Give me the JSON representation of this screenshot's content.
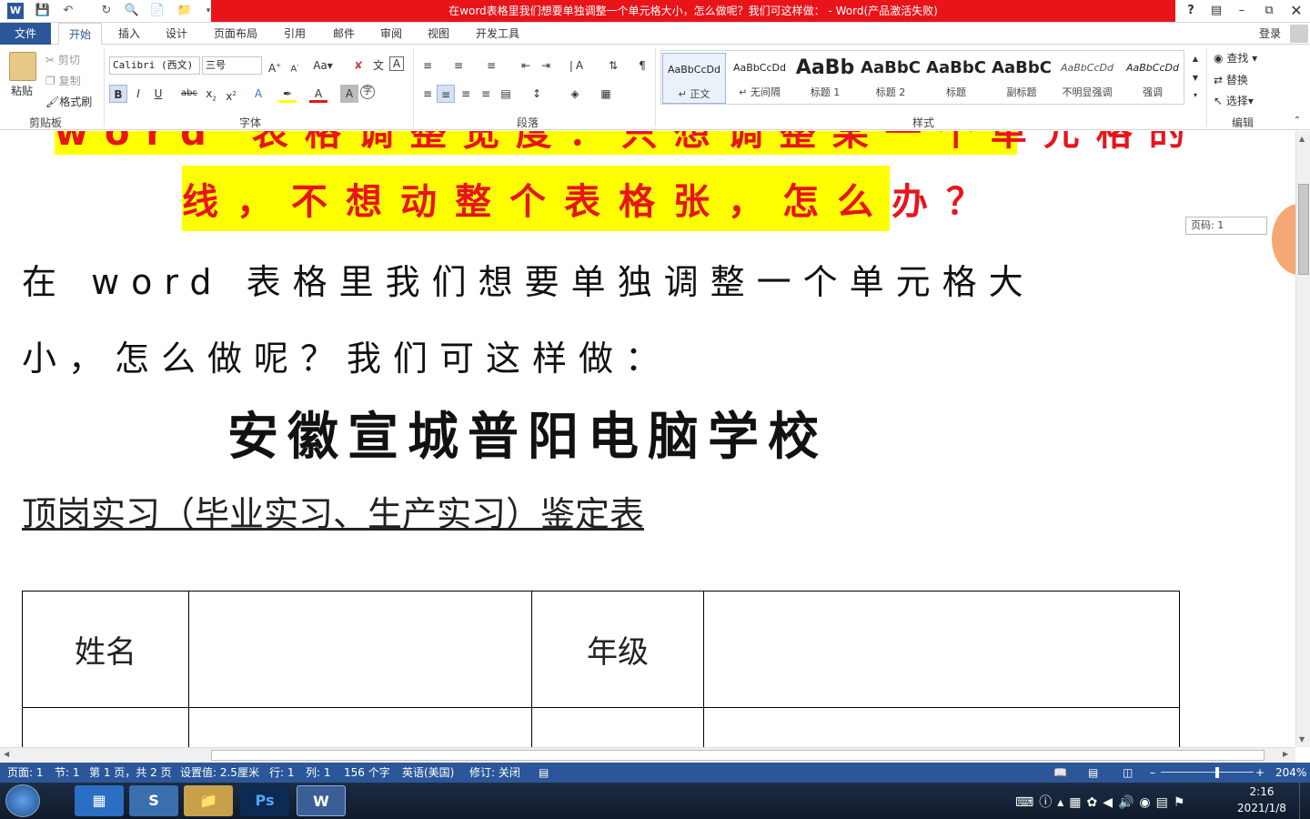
{
  "window": {
    "title": "在word表格里我们想要单独调整一个单元格大小，怎么做呢？我们可这样做： - Word(产品激活失败)",
    "help": "?",
    "login": "登录"
  },
  "tabs": [
    "文件",
    "开始",
    "插入",
    "设计",
    "页面布局",
    "引用",
    "邮件",
    "审阅",
    "视图",
    "开发工具"
  ],
  "ribbon": {
    "clipboard": {
      "paste": "粘贴",
      "cut": "剪切",
      "copy": "复制",
      "format_painter": "格式刷",
      "label": "剪贴板"
    },
    "font": {
      "name": "Calibri (西文)",
      "size": "三号",
      "label": "字体"
    },
    "paragraph": {
      "label": "段落"
    },
    "styles": {
      "label": "样式",
      "items": [
        {
          "preview": "AaBbCcDd",
          "name": "↵ 正文"
        },
        {
          "preview": "AaBbCcDd",
          "name": "↵ 无间隔"
        },
        {
          "preview": "AaBb",
          "name": "标题 1"
        },
        {
          "preview": "AaBbC",
          "name": "标题 2"
        },
        {
          "preview": "AaBbC",
          "name": "标题"
        },
        {
          "preview": "AaBbC",
          "name": "副标题"
        },
        {
          "preview": "AaBbCcDd",
          "name": "不明显强调"
        },
        {
          "preview": "AaBbCcDd",
          "name": "强调"
        }
      ]
    },
    "editing": {
      "find": "查找",
      "replace": "替换",
      "select": "选择",
      "label": "编辑"
    }
  },
  "document": {
    "highlight_line1": "word 表格调整宽度：只想调整某一个单元格的",
    "highlight_line2": "线，不想动整个表格张，怎么办？",
    "body_line1": "在 word 表格里我们想要单独调整一个单元格大",
    "body_line2": "小，怎么做呢？我们可这样做：",
    "school": "安徽宣城普阳电脑学校",
    "form_title": "顶岗实习（毕业实习、生产实习）鉴定表",
    "table": {
      "name_label": "姓名",
      "grade_label": "年级"
    },
    "page_tooltip": "页码: 1"
  },
  "status": {
    "page": "页面: 1",
    "section": "节: 1",
    "pages": "第 1 页，共 2 页",
    "position": "设置值: 2.5厘米",
    "line": "行: 1",
    "column": "列: 1",
    "words": "156 个字",
    "language": "英语(美国)",
    "track": "修订: 关闭",
    "zoom": "204%"
  },
  "taskbar": {
    "time": "2:16",
    "date": "2021/1/8"
  },
  "colors": {
    "accent": "#2b579a",
    "title_red": "#e8141a",
    "highlight": "#ffff00"
  }
}
